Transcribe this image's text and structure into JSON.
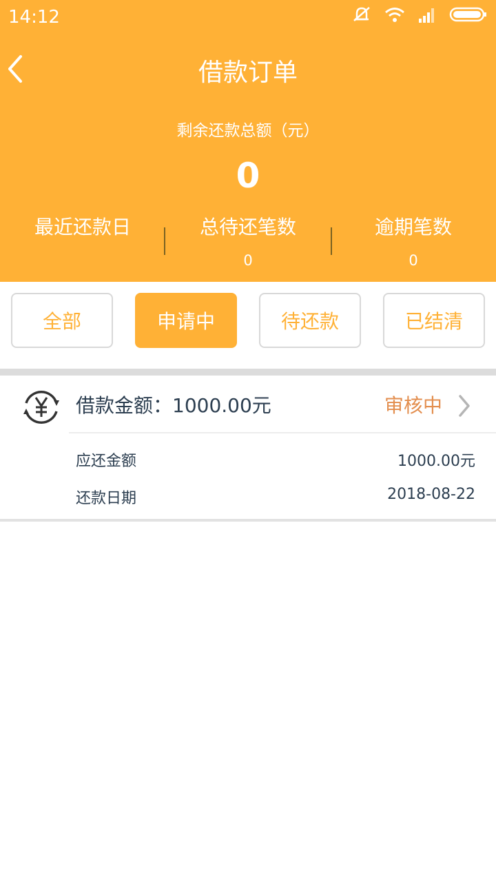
{
  "status_bar": {
    "time": "14:12"
  },
  "header": {
    "title": "借款订单",
    "remain_label": "剩余还款总额（元）",
    "remain_value": "0",
    "stats": [
      {
        "label": "最近还款日",
        "value": ""
      },
      {
        "label": "总待还笔数",
        "value": "0"
      },
      {
        "label": "逾期笔数",
        "value": "0"
      }
    ]
  },
  "tabs": [
    {
      "label": "全部",
      "active": false
    },
    {
      "label": "申请中",
      "active": true
    },
    {
      "label": "待还款",
      "active": false
    },
    {
      "label": "已结清",
      "active": false
    }
  ],
  "order": {
    "amount_text": "借款金额：1000.00元",
    "status": "审核中",
    "rows": [
      {
        "label": "应还金额",
        "value": "1000.00元"
      },
      {
        "label": "还款日期",
        "value": "2018-08-22"
      }
    ]
  },
  "colors": {
    "accent": "#FFB136",
    "status": "#E38E4E",
    "text": "#2c3e50"
  },
  "icons": [
    "back-icon",
    "mute-icon",
    "wifi-icon",
    "signal-icon",
    "battery-icon",
    "yen-icon",
    "chevron-right-icon"
  ]
}
